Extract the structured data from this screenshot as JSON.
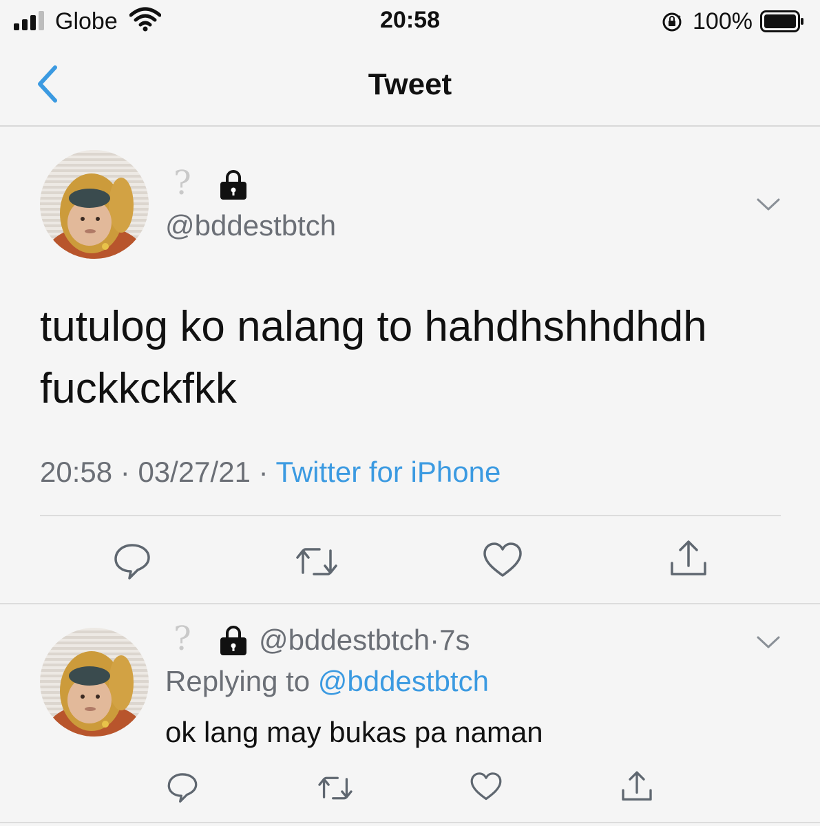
{
  "status_bar": {
    "carrier": "Globe",
    "time": "20:58",
    "battery_percent": "100%",
    "signal_bars_filled": 3,
    "signal_bars_total": 4
  },
  "nav": {
    "title": "Tweet"
  },
  "tweet": {
    "display_name": "?",
    "handle": "@bddestbtch",
    "text": "tutulog ko nalang to hahdhshhdhdh fuckkckfkk",
    "time": "20:58",
    "date": "03/27/21",
    "separator": " · ",
    "source": "Twitter for iPhone"
  },
  "reply": {
    "display_name": "?",
    "handle": "@bddestbtch",
    "age": "·7s",
    "replying_label": "Replying to",
    "replying_to": "@bddestbtch",
    "text": "ok lang may bukas pa naman"
  },
  "colors": {
    "link": "#3b9ae1",
    "muted": "#6b6f76",
    "icon": "#5f6770"
  },
  "icons": [
    "signal-icon",
    "wifi-icon",
    "rotation-lock-icon",
    "battery-icon",
    "back-chevron-icon",
    "lock-icon",
    "chevron-down-icon",
    "reply-icon",
    "retweet-icon",
    "like-icon",
    "share-icon"
  ]
}
